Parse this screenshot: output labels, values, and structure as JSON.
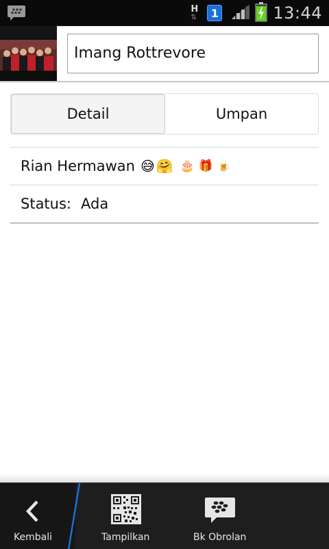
{
  "status_bar": {
    "network_letter": "H",
    "notification_count": "1",
    "time": "13:44"
  },
  "header": {
    "contact_display_name": "Imang Rottrevore"
  },
  "tabs": [
    {
      "label": "Detail",
      "active": true
    },
    {
      "label": "Umpan",
      "active": false
    }
  ],
  "details": {
    "name": "Rian Hermawan",
    "name_emojis": [
      "😅",
      "🤗",
      "🎂",
      "🎁",
      "🍺"
    ],
    "status_label": "Status:",
    "status_value": "Ada"
  },
  "bottom_bar": {
    "back_label": "Kembali",
    "show_label": "Tampilkan",
    "chat_label": "Bk Obrolan"
  },
  "colors": {
    "status_bar_bg": "#0a0a0a",
    "notification_badge": "#1a6fd8",
    "battery_green": "#5fd41c",
    "bottom_bar_bg": "#1e1e1e",
    "divider_accent": "#1a6fd8"
  }
}
